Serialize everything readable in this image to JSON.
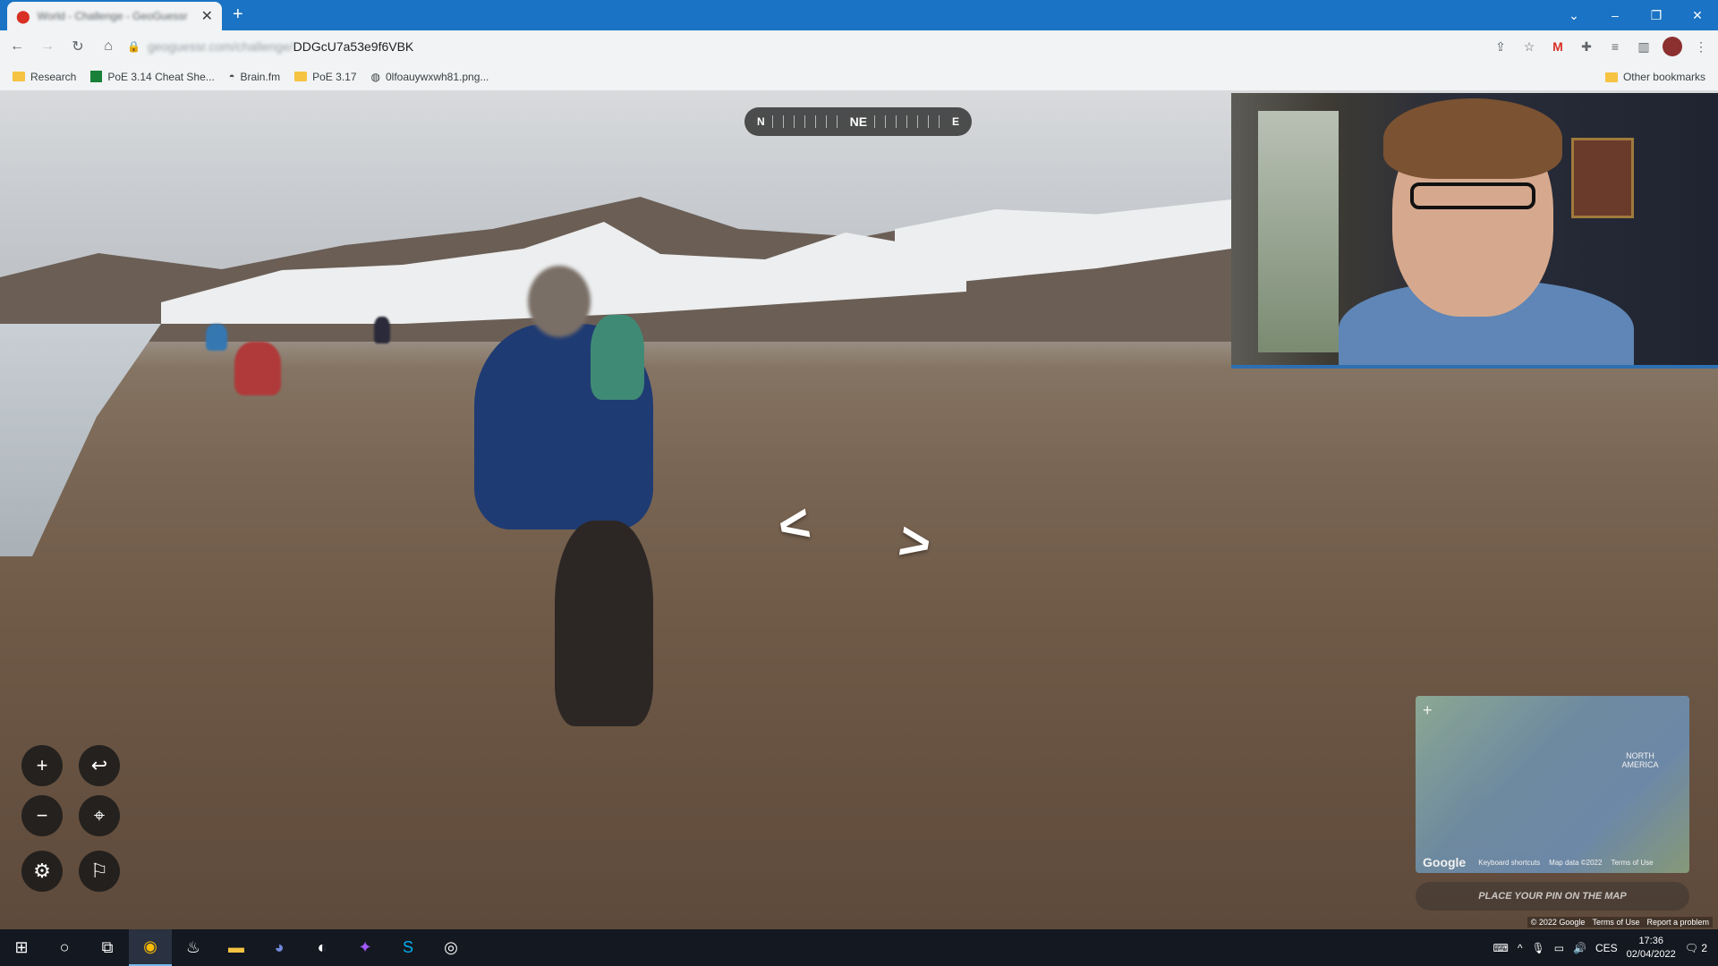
{
  "browser": {
    "tab_title": "World - Challenge - GeoGuessr",
    "new_tab_label": "+",
    "url_host": "geoguessr.com/challenge/",
    "url_path": "DDGcU7a53e9f6VBK",
    "window_controls": [
      "⌄",
      "–",
      "❐",
      "✕"
    ]
  },
  "bookmarks": {
    "items": [
      {
        "label": "Research",
        "icon": "folder-icon"
      },
      {
        "label": "PoE 3.14 Cheat She...",
        "icon": "sheets-icon"
      },
      {
        "label": "Brain.fm",
        "icon": "brainfm-icon"
      },
      {
        "label": "PoE 3.17",
        "icon": "folder-icon"
      },
      {
        "label": "0lfoauywxwh81.png...",
        "icon": "globe-icon"
      }
    ],
    "other": "Other bookmarks"
  },
  "game": {
    "compass": {
      "left": "N",
      "center": "NE",
      "right": "E"
    },
    "minimap_label": "NORTH AMERICA",
    "minimap_attrib": {
      "keyboard": "Keyboard shortcuts",
      "mapdata": "Map data ©2022",
      "terms": "Terms of Use"
    },
    "place_pin": "PLACE YOUR PIN ON THE MAP",
    "footer": {
      "copyright": "© 2022 Google",
      "terms": "Terms of Use",
      "report": "Report a problem"
    }
  },
  "taskbar": {
    "apps": [
      "chrome-icon",
      "steam-icon",
      "explorer-icon",
      "discord-icon",
      "app-icon",
      "messenger-icon",
      "skype-icon",
      "obs-icon"
    ],
    "lang": "CES",
    "time": "17:36",
    "date": "02/04/2022",
    "notifications": "2"
  }
}
